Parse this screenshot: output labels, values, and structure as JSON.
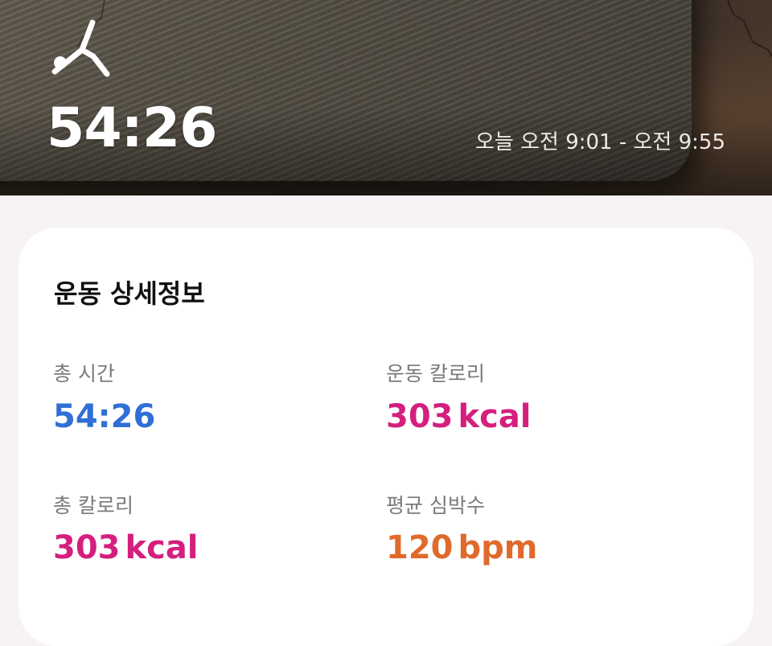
{
  "header": {
    "workout_icon": "yoga-pose-icon",
    "duration": "54:26",
    "time_range": "오늘 오전 9:01 - 오전 9:55"
  },
  "details": {
    "title": "운동 상세정보",
    "stats": [
      {
        "label": "총 시간",
        "value": "54:26",
        "unit": "",
        "color": "#2f6fd6"
      },
      {
        "label": "운동 칼로리",
        "value": "303",
        "unit": "kcal",
        "color": "#d41f7e"
      },
      {
        "label": "총 칼로리",
        "value": "303",
        "unit": "kcal",
        "color": "#d41f7e"
      },
      {
        "label": "평균 심박수",
        "value": "120",
        "unit": "bpm",
        "color": "#e06a2b"
      }
    ]
  }
}
